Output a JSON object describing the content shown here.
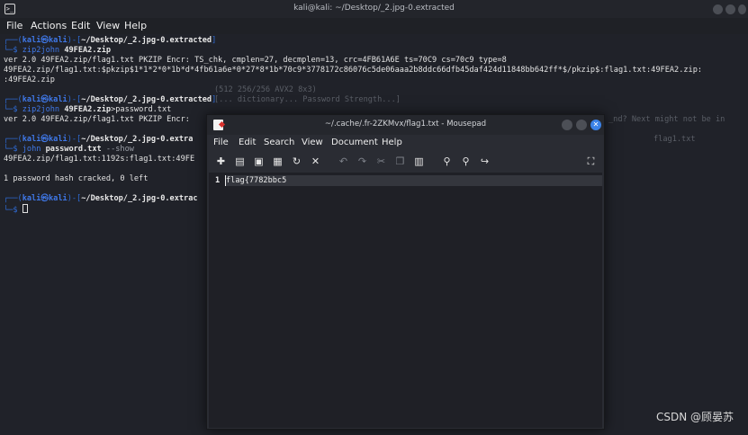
{
  "terminal": {
    "title": "kali@kali: ~/Desktop/_2.jpg-0.extracted",
    "app_icon_glyph": ">_",
    "menu": [
      "File",
      "Actions",
      "Edit",
      "View",
      "Help"
    ],
    "prompt": {
      "box_top": "┌──(",
      "user": "kali㉿kali",
      "mid": ")-[",
      "end": "]",
      "box_bottom": "└─",
      "dollar": "$ "
    },
    "blocks": [
      {
        "path": "~/Desktop/_2.jpg-0.extracted",
        "cmd": "zip2john",
        "arg": "49FEA2.zip",
        "flag": "",
        "rest": "",
        "output": [
          "ver 2.0 49FEA2.zip/flag1.txt PKZIP Encr: TS_chk, cmplen=27, decmplen=13, crc=4FB61A6E ts=70C9 cs=70c9 type=8",
          "49FEA2.zip/flag1.txt:$pkzip$1*1*2*0*1b*d*4fb61a6e*0*27*8*1b*70c9*3778172c86076c5de06aaa2b8ddc66dfb45daf424d11848bb642ff*$/pkzip$:flag1.txt:49FEA2.zip:",
          ":49FEA2.zip"
        ]
      },
      {
        "path": "~/Desktop/_2.jpg-0.extracted",
        "cmd": "zip2john",
        "arg": "49FEA2.zip",
        "flag": "",
        "rest": ">password.txt",
        "output": [
          "ver 2.0 49FEA2.zip/flag1.txt PKZIP Encr:"
        ]
      },
      {
        "path": "~/Desktop/_2.jpg-0.extra",
        "cmd": "john",
        "arg": "password.txt",
        "flag": "--show",
        "rest": "",
        "output": [
          "49FEA2.zip/flag1.txt:1192s:flag1.txt:49FE",
          "",
          "1 password hash cracked, 0 left"
        ]
      },
      {
        "path": "~/Desktop/_2.jpg-0.extrac",
        "cmd": "",
        "arg": "",
        "flag": "",
        "rest": "",
        "output": []
      }
    ],
    "faded_lines": [
      "(512 256/256 AVX2 8x3)",
      "[... dictionary... Password Strength...]",
      "_nd? Next might not be in",
      "flag1.txt"
    ]
  },
  "mousepad": {
    "title": "~/.cache/.fr-2ZKMvx/flag1.txt - Mousepad",
    "menu": [
      "File",
      "Edit",
      "Search",
      "View",
      "Document",
      "Help"
    ],
    "toolbar_icons": [
      "new-document-icon",
      "open-icon",
      "save-icon",
      "save-as-icon",
      "reload-icon",
      "close-document-icon",
      "undo-icon",
      "redo-icon",
      "cut-icon",
      "copy-icon",
      "paste-icon",
      "find-icon",
      "find-replace-icon",
      "go-to-line-icon",
      "fullscreen-icon"
    ],
    "line_number": "1",
    "content": "flag{7782bbc5"
  },
  "watermark": "CSDN @顾晏苏"
}
